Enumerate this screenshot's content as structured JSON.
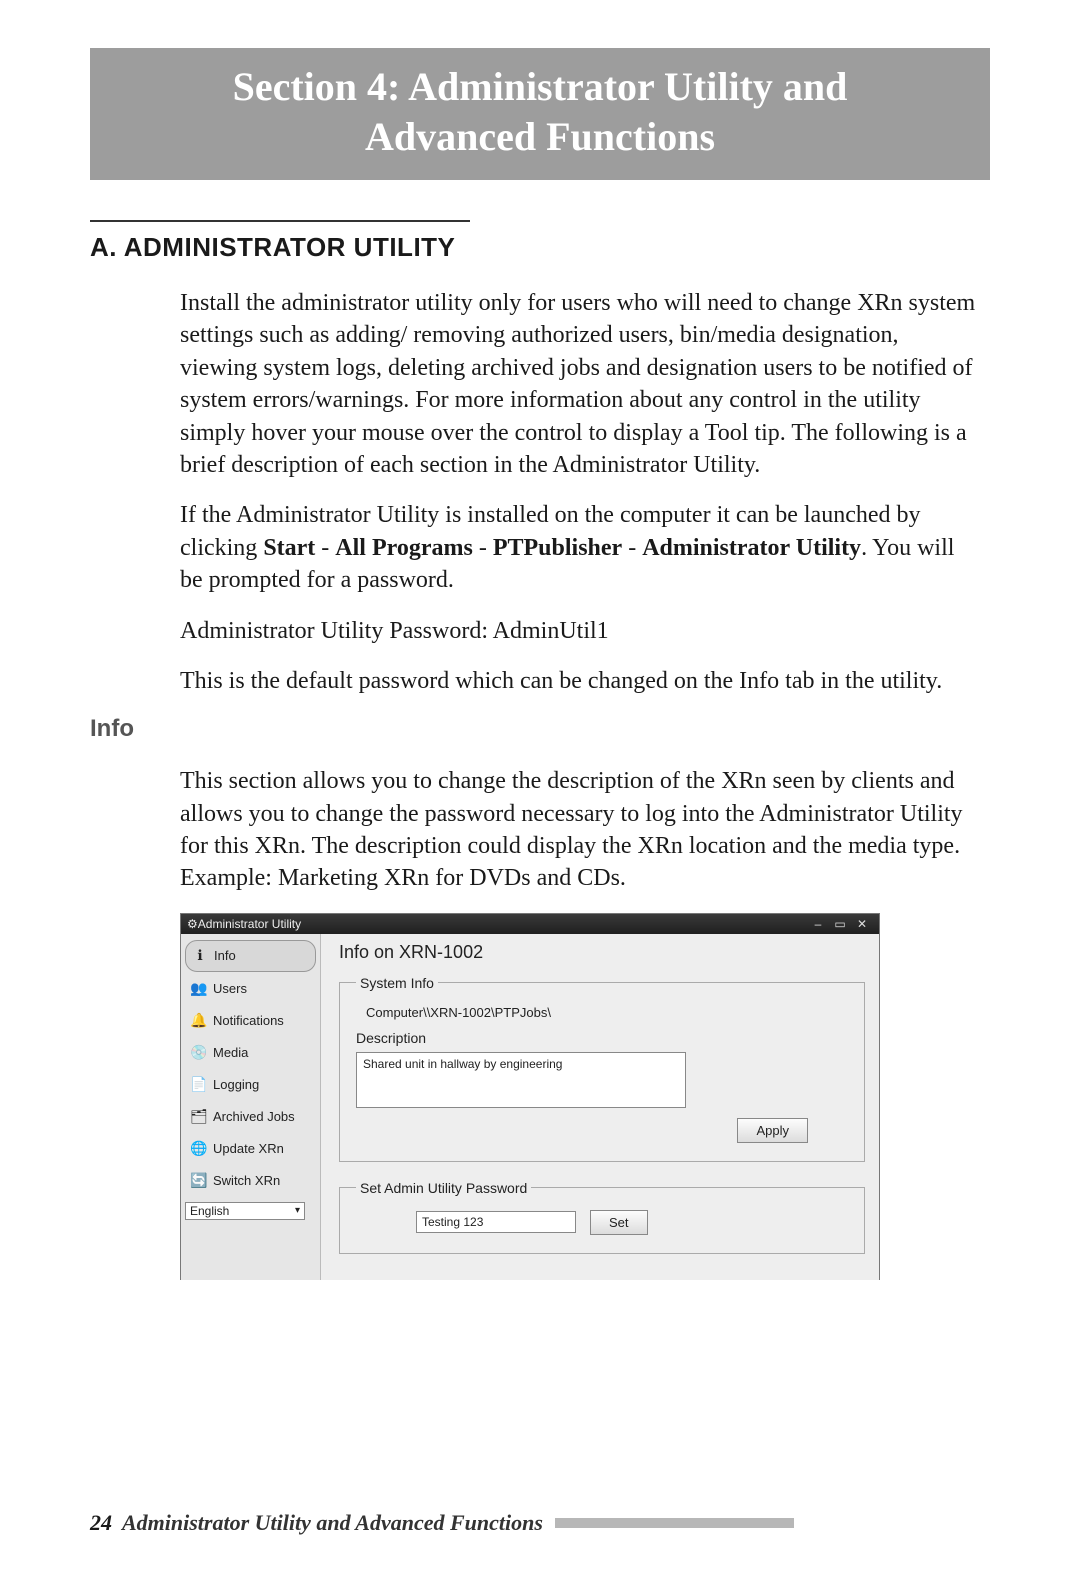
{
  "banner": {
    "line1": "Section 4:   Administrator Utility and",
    "line2": "Advanced Functions"
  },
  "section_head": "A. ADMINISTRATOR UTILITY",
  "para1": "Install the administrator utility only for users who will need to change XRn system settings such as adding/ removing authorized users, bin/media designation, viewing system logs, deleting archived jobs and designation users to be notified of system errors/warnings. For more information about any control in the utility simply hover your mouse over the control to display a Tool tip.  The following is a brief description of each section in the Administrator Utility.",
  "para2_pre": "If the Administrator Utility is installed on the computer it can be launched by clicking ",
  "para2_b1": "Start",
  "para2_s1": " - ",
  "para2_b2": "All Programs",
  "para2_s2": " - ",
  "para2_b3": "PTPublisher",
  "para2_s3": " - ",
  "para2_b4": "Administrator Utility",
  "para2_post": ".  You will be prompted for a password.",
  "para3": "Administrator Utility Password: AdminUtil1",
  "para4": "This is the default password which can be changed on the Info tab in the utility.",
  "subhead_info": "Info",
  "para_info": "This section allows you to change the description of the XRn seen by clients and allows you to change the password necessary to log into the Administrator Utility for this XRn. The description could display the XRn location and the media type. Example: Marketing XRn for DVDs and CDs.",
  "app": {
    "title": "Administrator Utility",
    "sidebar": {
      "items": [
        {
          "label": "Info"
        },
        {
          "label": "Users"
        },
        {
          "label": "Notifications"
        },
        {
          "label": "Media"
        },
        {
          "label": "Logging"
        },
        {
          "label": "Archived Jobs"
        },
        {
          "label": "Update XRn"
        },
        {
          "label": "Switch XRn"
        }
      ],
      "language": "English"
    },
    "content": {
      "heading": "Info on XRN-1002",
      "sysinfo_legend": "System Info",
      "computer_path": "Computer\\\\XRN-1002\\PTPJobs\\",
      "description_label": "Description",
      "description_value": "Shared unit in hallway by engineering",
      "apply_label": "Apply",
      "pw_legend": "Set Admin Utility Password",
      "pw_value": "Testing 123",
      "set_label": "Set"
    }
  },
  "footer": {
    "page": "24",
    "title": "Administrator Utility and Advanced Functions"
  }
}
